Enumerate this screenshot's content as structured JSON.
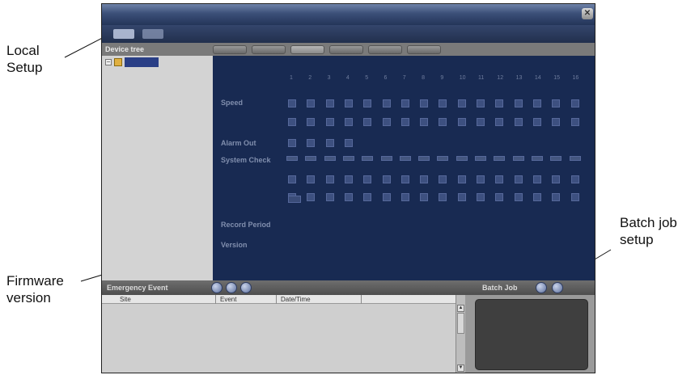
{
  "callouts": {
    "local_setup": "Local\nSetup",
    "firmware_version": "Firmware\nversion",
    "batch_job_setup": "Batch job\nsetup"
  },
  "window": {
    "close_glyph": "✕"
  },
  "device_tree": {
    "header": "Device tree",
    "expander_glyph": "−"
  },
  "main": {
    "labels": {
      "row1": "Speed",
      "alarm_out": "Alarm Out",
      "system_check": "System Check",
      "record_period": "Record Period",
      "version": "Version"
    },
    "channel_numbers": [
      "1",
      "2",
      "3",
      "4",
      "5",
      "6",
      "7",
      "8",
      "9",
      "10",
      "11",
      "12",
      "13",
      "14",
      "15",
      "16"
    ]
  },
  "bottom": {
    "emergency_label": "Emergency Event",
    "batch_label": "Batch Job",
    "columns": [
      "Site",
      "Event",
      "Date/Time"
    ],
    "scroll_up": "▲",
    "scroll_down": "▼"
  },
  "colors": {
    "panel_blue": "#182a52",
    "titlebar": "#3b4f78",
    "tree_bg": "#d3d3d3",
    "chrome_gray": "#7a7a7a"
  }
}
